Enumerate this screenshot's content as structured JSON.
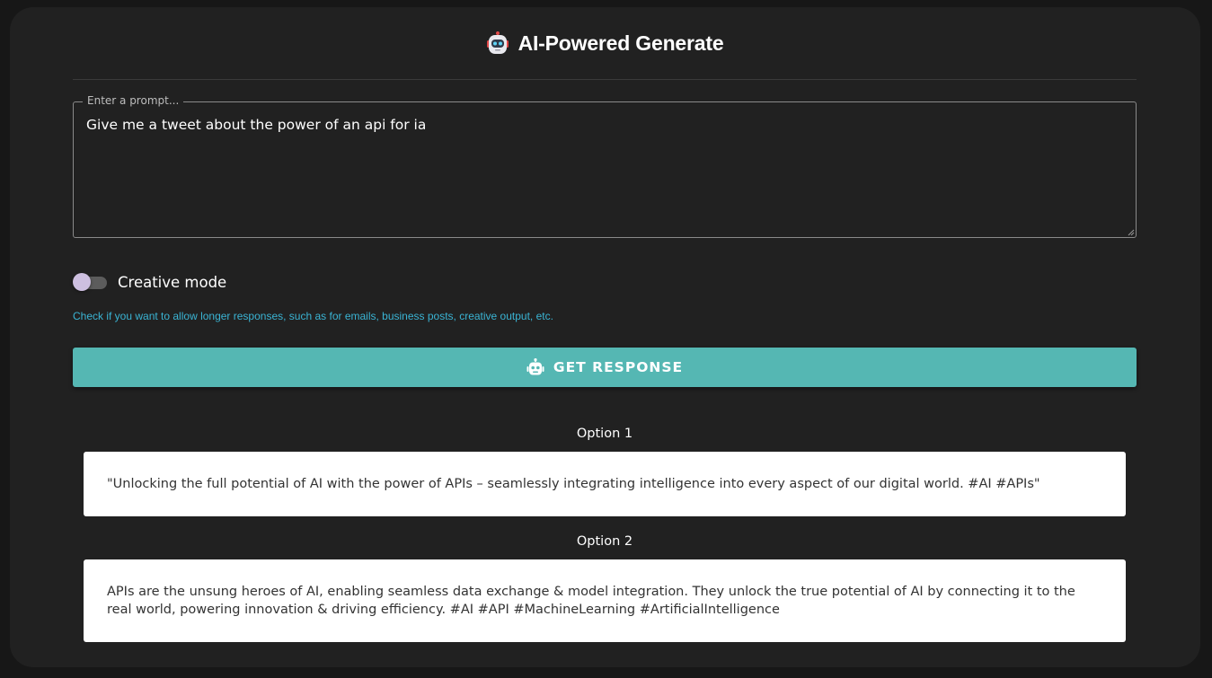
{
  "header": {
    "title": "AI-Powered Generate",
    "icon": "robot-face-icon"
  },
  "prompt": {
    "label": "Enter a prompt...",
    "value": "Give me a tweet about the power of an api for ia"
  },
  "creative_mode": {
    "label": "Creative mode",
    "checked": false,
    "hint": "Check if you want to allow longer responses, such as for emails, business posts, creative output, etc."
  },
  "action": {
    "button_label": "GET RESPONSE",
    "icon": "robot-icon"
  },
  "options": [
    {
      "title": "Option 1",
      "text": "\"Unlocking the full potential of AI with the power of APIs – seamlessly integrating intelligence into every aspect of our digital world. #AI #APIs\""
    },
    {
      "title": "Option 2",
      "text": "APIs are the unsung heroes of AI, enabling seamless data exchange & model integration. They unlock the true potential of AI by connecting it to the real world, powering innovation & driving efficiency. #AI #API #MachineLearning #ArtificialIntelligence"
    }
  ],
  "colors": {
    "page_background": "#171717",
    "card_background": "#212121",
    "button": "#55b7b3",
    "hint_text": "#3ab4d4",
    "switch_thumb": "#cdbfe0"
  }
}
